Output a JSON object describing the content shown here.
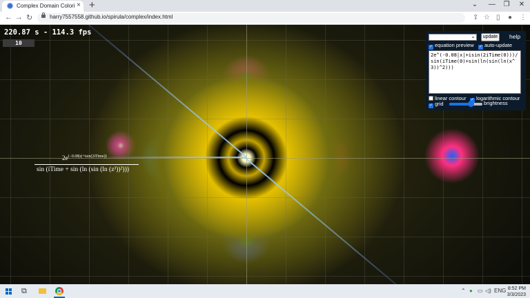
{
  "browser": {
    "tab_title": "Complex Domain Coloring Graph",
    "tab_close": "×",
    "new_tab": "+",
    "url": "harry7557558.github.io/spirula/complex/index.html",
    "window_controls": {
      "dropdown": "⌄",
      "minimize": "—",
      "restore": "❐",
      "close": "✕"
    },
    "nav": {
      "back": "←",
      "forward": "→",
      "reload": "↻"
    },
    "toolbar_icons": [
      "share-icon",
      "star-icon",
      "sidebar-icon",
      "profile-icon",
      "menu-icon"
    ]
  },
  "canvas": {
    "status": "220.87 s - 114.3 fps",
    "counter": "10",
    "formula": {
      "numerator_base": "2e",
      "numerator_exponent": "(−0.08|z|+isin(2iTime))",
      "denominator": "sin (iTime + sin (ln (sin (ln (z³))²)))"
    }
  },
  "panel": {
    "update_label": "update",
    "help_label": "help",
    "equation_preview": {
      "label": "equation preview",
      "checked": true
    },
    "auto_update": {
      "label": "auto-update",
      "checked": true
    },
    "equation_text": "2e^(-0.08|x|+isin(2iTime(0)))/sin(iTime(0)+sin(ln(sin(ln(x^3))^2)))",
    "linear_contour": {
      "label": "linear contour",
      "checked": false
    },
    "log_contour": {
      "label": "logarithmic contour",
      "checked": true
    },
    "grid": {
      "label": "grid",
      "checked": true
    },
    "brightness_label": "brightness",
    "brightness_level": 0.65
  },
  "taskbar": {
    "tray_lang": "ENG",
    "time": "8:52 PM",
    "date": "3/3/2023"
  }
}
